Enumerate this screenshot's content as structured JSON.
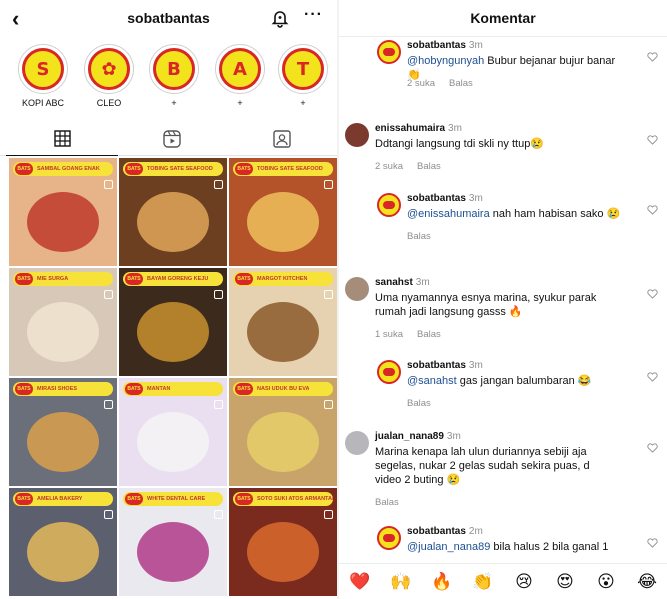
{
  "profile": {
    "username": "sobatbantas",
    "back_icon": "chevron-left-icon",
    "notification_icon": "bell-plus-icon",
    "more_icon": "more-horizontal-icon"
  },
  "highlights": [
    {
      "letter": "S",
      "label": "KOPI ABC"
    },
    {
      "letter": "✿",
      "label": "CLEO"
    },
    {
      "letter": "B",
      "label": "+"
    },
    {
      "letter": "A",
      "label": "+"
    },
    {
      "letter": "T",
      "label": "+"
    }
  ],
  "tabs": [
    {
      "icon": "grid-icon"
    },
    {
      "icon": "reels-icon"
    },
    {
      "icon": "tagged-icon"
    }
  ],
  "posts": [
    {
      "title": "SAMBAL GOANG ENAK",
      "bg": "#e7b48a",
      "food": "#c0392b"
    },
    {
      "title": "TOBING SATE SEAFOOD",
      "bg": "#6b3f1f",
      "food": "#e0a65c"
    },
    {
      "title": "TOBING SATE SEAFOOD",
      "bg": "#b4532a",
      "food": "#f0c05a"
    },
    {
      "title": "MIE SURGA",
      "bg": "#d8c8b8",
      "food": "#f1e4d0"
    },
    {
      "title": "BAYAM GORENG KEJU",
      "bg": "#3c2a1c",
      "food": "#c8912e"
    },
    {
      "title": "MARGOT KITCHEN",
      "bg": "#e6d2b0",
      "food": "#8a5a2b"
    },
    {
      "title": "MIRASI SHOES",
      "bg": "#6b6f7a",
      "food": "#d9a04b"
    },
    {
      "title": "MANTAN",
      "bg": "#e9dff0",
      "food": "#f5f5f5"
    },
    {
      "title": "NASI UDUK BU EVA",
      "bg": "#c9a46a",
      "food": "#e7cf6a"
    },
    {
      "title": "AMELIA BAKERY",
      "bg": "#5c5f6e",
      "food": "#e3b85a"
    },
    {
      "title": "WHITE DENTAL CARE",
      "bg": "#e9e9ef",
      "food": "#b03a8a"
    },
    {
      "title": "SOTO SUKI ATOS ARMANTAN",
      "bg": "#7b2b1e",
      "food": "#d96a2e"
    }
  ],
  "comments_panel": {
    "title": "Komentar",
    "comments": [
      {
        "user": "sobatbantas",
        "time": "3m",
        "mention": "@hobyngunyah",
        "text": " Bubur bejanar bujur banar 👏",
        "likes": "2 suka",
        "reply": "Balas",
        "is_reply": true
      },
      {
        "user": "enissahumaira",
        "time": "3m",
        "mention": "",
        "text": "Ddtangi langsung tdi skli ny ttup😢",
        "likes": "2 suka",
        "reply": "Balas",
        "is_reply": false
      },
      {
        "user": "sobatbantas",
        "time": "3m",
        "mention": "@enissahumaira",
        "text": " nah ham habisan sako 😢",
        "likes": "",
        "reply": "Balas",
        "is_reply": true
      },
      {
        "user": "sanahst",
        "time": "3m",
        "mention": "",
        "text": "Uma nyamannya esnya marina, syukur parak rumah jadi langsung gasss 🔥",
        "likes": "1 suka",
        "reply": "Balas",
        "is_reply": false
      },
      {
        "user": "sobatbantas",
        "time": "3m",
        "mention": "@sanahst",
        "text": " gas jangan balumbaran 😂",
        "likes": "",
        "reply": "Balas",
        "is_reply": true
      },
      {
        "user": "jualan_nana89",
        "time": "3m",
        "mention": "",
        "text": "Marina kenapa lah ulun duriannya sebiji aja segelas, nukar 2 gelas sudah sekira puas, d video 2 buting 😢",
        "likes": "",
        "reply": "Balas",
        "is_reply": false
      },
      {
        "user": "sobatbantas",
        "time": "2m",
        "mention": "@jualan_nana89",
        "text": " bila halus 2 bila ganal 1",
        "likes": "",
        "reply": "",
        "is_reply": true
      }
    ],
    "emoji_bar": [
      "❤️",
      "🙌",
      "🔥",
      "👏",
      "😢",
      "😍",
      "😮",
      "😂"
    ]
  },
  "colors": {
    "mention": "#1d4f91",
    "muted": "#8e8e8e",
    "brand_yellow": "#f3e31c",
    "brand_red": "#d92626"
  }
}
